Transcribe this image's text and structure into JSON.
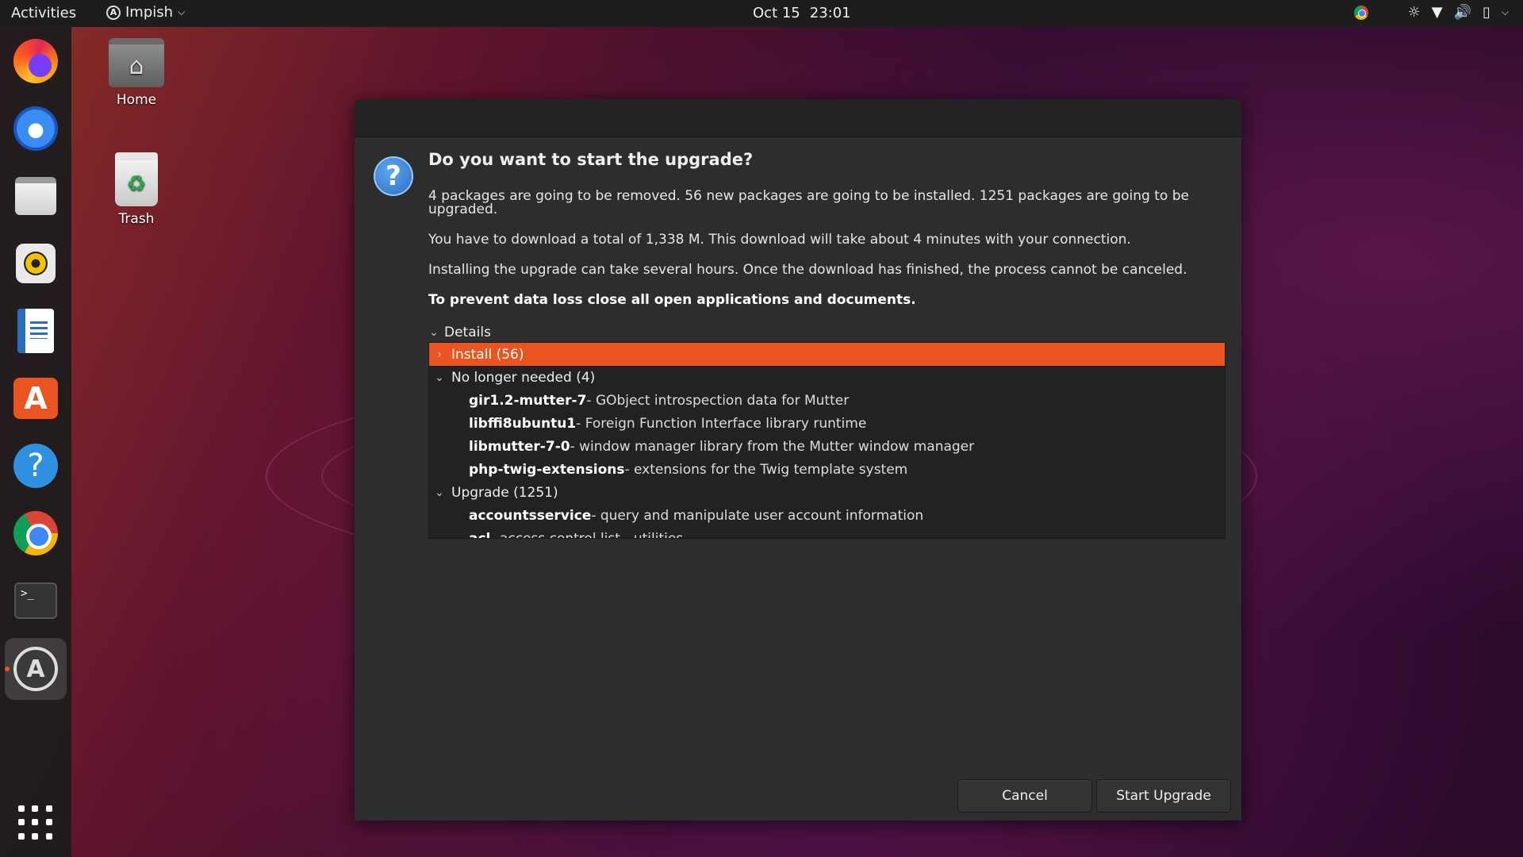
{
  "topbar": {
    "activities": "Activities",
    "app_name": "Impish",
    "date": "Oct 15",
    "time": "23:01"
  },
  "dock": {
    "items": [
      {
        "name": "firefox",
        "icon": "firefox-icon"
      },
      {
        "name": "thunderbird",
        "icon": "thunderbird-icon"
      },
      {
        "name": "files",
        "icon": "files-icon"
      },
      {
        "name": "rhythmbox",
        "icon": "rhythmbox-icon"
      },
      {
        "name": "libreoffice-writer",
        "icon": "writer-icon"
      },
      {
        "name": "ubuntu-software",
        "icon": "software-store-icon"
      },
      {
        "name": "help",
        "icon": "help-icon"
      },
      {
        "name": "chrome",
        "icon": "chrome-icon"
      },
      {
        "name": "terminal",
        "icon": "terminal-icon"
      },
      {
        "name": "software-updater",
        "icon": "software-updater-icon"
      }
    ],
    "show_apps_icon": "app-grid-icon"
  },
  "desktop": {
    "home_label": "Home",
    "trash_label": "Trash"
  },
  "dialog": {
    "heading": "Do you want to start the upgrade?",
    "para1": "4 packages are going to be removed. 56 new packages are going to be installed. 1251 packages are going to be upgraded.",
    "para2": "You have to download a total of 1,338 M. This download will take about 4 minutes with your connection.",
    "para3": "Installing the upgrade can take several hours. Once the download has finished, the process cannot be canceled.",
    "warning": "To prevent data loss close all open applications and documents.",
    "details_label": "Details",
    "tree": {
      "install_group": "Install (56)",
      "no_longer_group": "No longer needed (4)",
      "no_longer_items": [
        {
          "name": "gir1.2-mutter-7",
          "desc": " - GObject introspection data for Mutter"
        },
        {
          "name": "libffi8ubuntu1",
          "desc": " - Foreign Function Interface library runtime"
        },
        {
          "name": "libmutter-7-0",
          "desc": " - window manager library from the Mutter window manager"
        },
        {
          "name": "php-twig-extensions",
          "desc": " - extensions for the Twig template system"
        }
      ],
      "upgrade_group": "Upgrade (1251)",
      "upgrade_items": [
        {
          "name": "accountsservice",
          "desc": " - query and manipulate user account information"
        },
        {
          "name": "acl",
          "desc": " - access control list - utilities"
        }
      ]
    },
    "cancel_label": "Cancel",
    "start_label": "Start Upgrade"
  },
  "colors": {
    "accent": "#e95420",
    "dialog_bg": "#2d2d2d",
    "topbar_bg": "#1d1d1d"
  }
}
